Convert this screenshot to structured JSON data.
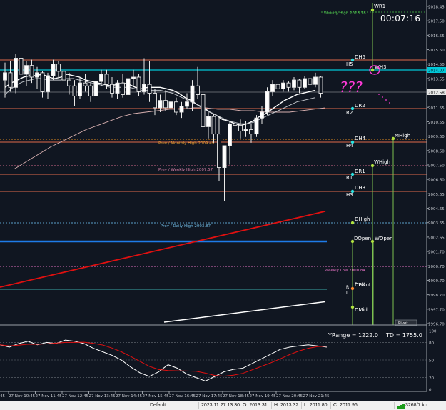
{
  "timer": "00:07:16",
  "colors": {
    "background": "#101621",
    "price_line": "#00c8d8",
    "current_price_tag": "#2c2c2c",
    "ma_fast": "#ffffff",
    "ma_red": "#e01010",
    "ma_white_long": "#ffffff",
    "ma_slow": "#d8b0b0",
    "daily_level": "#e06a4a",
    "monthly_level": "#e08a20",
    "weekly_level": "#e06a4a",
    "blue_line": "#1e7be8",
    "marker_cyan": "#2be0e0",
    "marker_green": "#b0e040"
  },
  "price_axis": {
    "ticks": [
      "2018.45",
      "2017.50",
      "2016.55",
      "2015.60",
      "2014.50",
      "2013.55",
      "2012.60",
      "2011.55",
      "2010.55",
      "2009.60",
      "2008.60",
      "2007.60",
      "2006.60",
      "2005.65",
      "2004.65",
      "2003.65",
      "2002.65",
      "2001.70",
      "2000.70",
      "1999.70",
      "1998.70",
      "1997.70",
      "1996.70"
    ],
    "current_price_tag": "2012.58",
    "cyan_line_tag": "2014.07"
  },
  "time_axis": {
    "labels": [
      "27 Nov 10:45",
      "27 Nov 11:45",
      "27 Nov 12:45",
      "27 Nov 13:45",
      "27 Nov 14:45",
      "27 Nov 15:45",
      "27 Nov 16:45",
      "27 Nov 17:45",
      "27 Nov 18:45",
      "27 Nov 19:45",
      "27 Nov 20:45",
      "27 Nov 21:45"
    ],
    "left_clipped": "45"
  },
  "levels": {
    "weekly_high_top": "Weekly High 2018.18",
    "prev_monthly_high": "Prev / Monthly High 2009.49",
    "prev_weekly_high": "Prev / Weekly High 2007.57",
    "prev_daily_high": "Prev / Daily High 2003.87",
    "weekly_low": "Weekly Low 2000.84"
  },
  "markers": {
    "wr1": "WR1",
    "wh3": "WH3",
    "dh5": "DH5",
    "h5": "H5",
    "dr2": "DR2",
    "r2": "R2",
    "dh4": "DH4",
    "h4": "H4",
    "mhigh": "MHigh",
    "whigh": "WHigh",
    "dr1": "DR1",
    "r1": "R1",
    "dh3": "DH3",
    "h3": "H3",
    "dhigh": "DHigh",
    "dopen": "DOpen",
    "wopen": "WOpen",
    "dpivot": "DPivot",
    "pivot": "Pivot",
    "r": "R",
    "l": "L",
    "dmid": "DMid",
    "pivot_box": "Pivot"
  },
  "annotation": "???",
  "oscillator": {
    "range_text": "YRange = 1222.0",
    "td_text": "TD = 1755.0",
    "ticks": [
      "100",
      "80",
      "50",
      "20",
      "0"
    ]
  },
  "status_bar": {
    "profile": "Default",
    "datetime": "2023.11.27 13:30",
    "open": "O: 2013.31",
    "high": "H: 2013.32",
    "low": "L: 2011.80",
    "close": "C: 2011.96",
    "traffic": "3268/7 kb"
  },
  "chart_data": {
    "type": "candlestick",
    "symbol_timeframe": "",
    "ylim": [
      1996.7,
      2018.45
    ],
    "candles": [
      [
        2013.4,
        2014.6,
        2012.2,
        2013.9
      ],
      [
        2013.9,
        2014.7,
        2012.6,
        2012.9
      ],
      [
        2012.9,
        2015.2,
        2012.5,
        2014.9
      ],
      [
        2014.9,
        2015.1,
        2013.4,
        2013.8
      ],
      [
        2013.8,
        2014.7,
        2013.0,
        2014.4
      ],
      [
        2014.4,
        2014.8,
        2013.2,
        2013.6
      ],
      [
        2013.6,
        2014.3,
        2012.8,
        2013.9
      ],
      [
        2013.9,
        2014.0,
        2012.2,
        2012.6
      ],
      [
        2012.6,
        2013.9,
        2012.1,
        2013.7
      ],
      [
        2013.7,
        2014.8,
        2013.4,
        2014.5
      ],
      [
        2014.5,
        2014.7,
        2013.6,
        2014.0
      ],
      [
        2014.0,
        2014.3,
        2013.1,
        2013.4
      ],
      [
        2013.4,
        2013.9,
        2012.4,
        2013.0
      ],
      [
        2013.0,
        2013.4,
        2011.6,
        2012.3
      ],
      [
        2012.3,
        2013.6,
        2012.1,
        2013.2
      ],
      [
        2013.2,
        2013.8,
        2012.6,
        2013.0
      ],
      [
        2013.0,
        2013.2,
        2011.9,
        2012.3
      ],
      [
        2012.3,
        2013.6,
        2012.0,
        2013.3
      ],
      [
        2013.3,
        2014.1,
        2013.0,
        2013.8
      ],
      [
        2013.8,
        2014.1,
        2012.8,
        2013.1
      ],
      [
        2013.1,
        2013.6,
        2012.2,
        2012.5
      ],
      [
        2012.5,
        2013.4,
        2012.1,
        2013.2
      ],
      [
        2013.2,
        2013.8,
        2012.2,
        2012.4
      ],
      [
        2012.4,
        2013.9,
        2012.1,
        2013.5
      ],
      [
        2013.5,
        2014.1,
        2013.0,
        2013.6
      ],
      [
        2013.6,
        2013.8,
        2012.3,
        2012.6
      ],
      [
        2012.6,
        2014.9,
        2012.4,
        2013.1
      ],
      [
        2013.1,
        2014.7,
        2011.9,
        2012.5
      ],
      [
        2012.5,
        2012.8,
        2011.0,
        2011.5
      ],
      [
        2011.5,
        2012.4,
        2011.2,
        2012.0
      ],
      [
        2012.0,
        2012.7,
        2011.3,
        2011.5
      ],
      [
        2011.5,
        2012.3,
        2010.9,
        2011.9
      ],
      [
        2011.9,
        2012.2,
        2011.0,
        2011.2
      ],
      [
        2011.2,
        2011.9,
        2010.8,
        2011.6
      ],
      [
        2011.6,
        2012.5,
        2011.4,
        2011.9
      ],
      [
        2011.9,
        2013.4,
        2011.3,
        2013.0
      ],
      [
        2013.0,
        2014.3,
        2012.1,
        2012.4
      ],
      [
        2012.4,
        2012.6,
        2009.8,
        2010.2
      ],
      [
        2010.2,
        2011.2,
        2009.4,
        2010.9
      ],
      [
        2010.9,
        2011.1,
        2009.1,
        2009.7
      ],
      [
        2009.7,
        2010.9,
        2006.5,
        2007.4
      ],
      [
        2007.4,
        2008.9,
        2005.1,
        2008.9
      ],
      [
        2008.9,
        2010.6,
        2007.6,
        2010.4
      ],
      [
        2010.4,
        2011.3,
        2009.8,
        2010.3
      ],
      [
        2010.3,
        2010.7,
        2009.4,
        2009.9
      ],
      [
        2009.9,
        2010.6,
        2009.5,
        2010.0
      ],
      [
        2010.0,
        2010.4,
        2009.1,
        2009.7
      ],
      [
        2009.7,
        2011.0,
        2009.5,
        2010.8
      ],
      [
        2010.8,
        2011.6,
        2010.4,
        2011.2
      ],
      [
        2011.2,
        2012.9,
        2011.0,
        2012.6
      ],
      [
        2012.6,
        2013.4,
        2012.3,
        2013.1
      ],
      [
        2013.1,
        2013.2,
        2012.4,
        2012.8
      ],
      [
        2012.8,
        2013.4,
        2012.6,
        2013.2
      ],
      [
        2013.2,
        2013.3,
        2012.6,
        2012.9
      ],
      [
        2012.9,
        2013.6,
        2012.7,
        2013.4
      ],
      [
        2013.4,
        2013.5,
        2012.5,
        2012.9
      ],
      [
        2012.9,
        2013.7,
        2012.8,
        2013.5
      ],
      [
        2013.5,
        2013.6,
        2012.7,
        2013.1
      ],
      [
        2013.1,
        2013.9,
        2012.9,
        2013.6
      ],
      [
        2013.6,
        2013.7,
        2012.2,
        2012.5
      ]
    ],
    "ma_fast": [
      2012.9,
      2013.2,
      2013.4,
      2013.6,
      2013.7,
      2013.7,
      2013.8,
      2013.6,
      2013.5,
      2013.6,
      2013.8,
      2013.7,
      2013.6,
      2013.4,
      2013.3,
      2013.2,
      2013.1,
      2013.0,
      2013.1,
      2013.2,
      2013.1,
      2012.9,
      2012.8,
      2012.9,
      2012.9,
      2012.9,
      2012.8,
      2012.7,
      2012.5,
      2012.2,
      2012.0,
      2011.7,
      2011.5,
      2011.2,
      2011.0,
      2010.7,
      2010.6,
      2010.4,
      2010.3,
      2010.4,
      2010.6,
      2010.9,
      2011.1,
      2011.4,
      2011.7,
      2012.0,
      2012.2,
      2012.4,
      2012.5,
      2012.6,
      2012.7
    ],
    "ma_mid": [
      2012.4,
      2012.8,
      2013.1,
      2013.3,
      2013.4,
      2013.5,
      2013.5,
      2013.4,
      2013.4,
      2013.4,
      2013.5,
      2013.5,
      2013.4,
      2013.3,
      2013.2,
      2013.1,
      2013.0,
      2012.9,
      2012.9,
      2012.9,
      2012.9,
      2012.8,
      2012.7,
      2012.7,
      2012.7,
      2012.7,
      2012.6,
      2012.5,
      2012.3,
      2012.1,
      2011.9,
      2011.7,
      2011.4,
      2011.2,
      2011.0,
      2010.8,
      2010.6,
      2010.5,
      2010.4,
      2010.4,
      2010.5,
      2010.7,
      2010.9,
      2011.1,
      2011.3,
      2011.5,
      2011.7,
      2011.9,
      2012.0,
      2012.1,
      2012.2
    ],
    "ma_slow": [
      2007.3,
      2007.8,
      2008.3,
      2008.8,
      2009.2,
      2009.6,
      2010.0,
      2010.3,
      2010.6,
      2010.9,
      2011.1,
      2011.2,
      2011.3,
      2011.4,
      2011.4,
      2011.5,
      2011.5,
      2011.4,
      2011.4,
      2011.3,
      2011.3,
      2011.2,
      2011.2,
      2011.2,
      2011.3,
      2011.4,
      2011.5
    ],
    "ma_red": [
      1999.2,
      2004.4
    ],
    "ma_white_long": [
      1996.8,
      1998.2
    ],
    "oscillator_values": [
      76,
      72,
      78,
      82,
      76,
      80,
      78,
      84,
      82,
      78,
      70,
      64,
      58,
      50,
      38,
      28,
      22,
      30,
      42,
      36,
      26,
      20,
      14,
      22,
      30,
      34,
      36,
      44,
      52,
      60,
      68,
      72,
      74,
      76,
      74,
      72
    ]
  }
}
